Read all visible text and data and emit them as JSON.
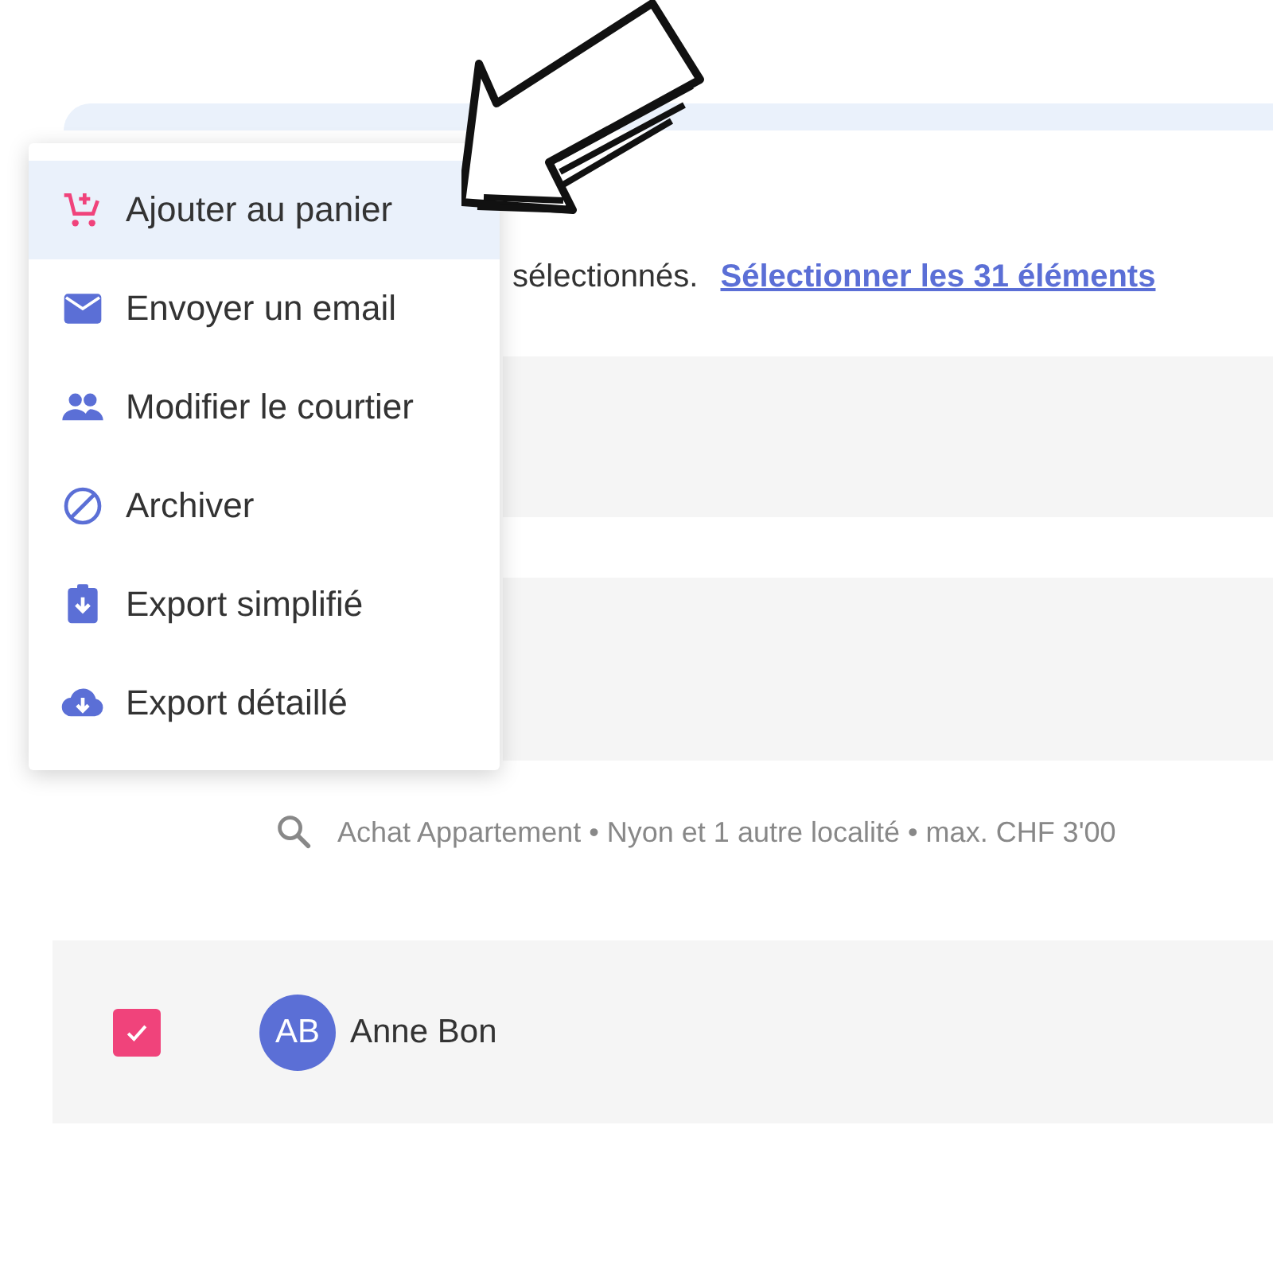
{
  "selection_bar": {
    "text": "sélectionnés.",
    "link": "Sélectionner les 31 éléments"
  },
  "search": {
    "summary": "Achat Appartement • Nyon et 1 autre localité • max. CHF 3'00"
  },
  "rows": [
    {
      "checked": true,
      "initials": "AB",
      "name": "Anne Bon"
    }
  ],
  "menu": {
    "items": [
      {
        "label": "Ajouter au panier",
        "selected": true
      },
      {
        "label": "Envoyer un email",
        "selected": false
      },
      {
        "label": "Modifier le courtier",
        "selected": false
      },
      {
        "label": "Archiver",
        "selected": false
      },
      {
        "label": "Export simplifié",
        "selected": false
      },
      {
        "label": "Export détaillé",
        "selected": false
      }
    ]
  }
}
